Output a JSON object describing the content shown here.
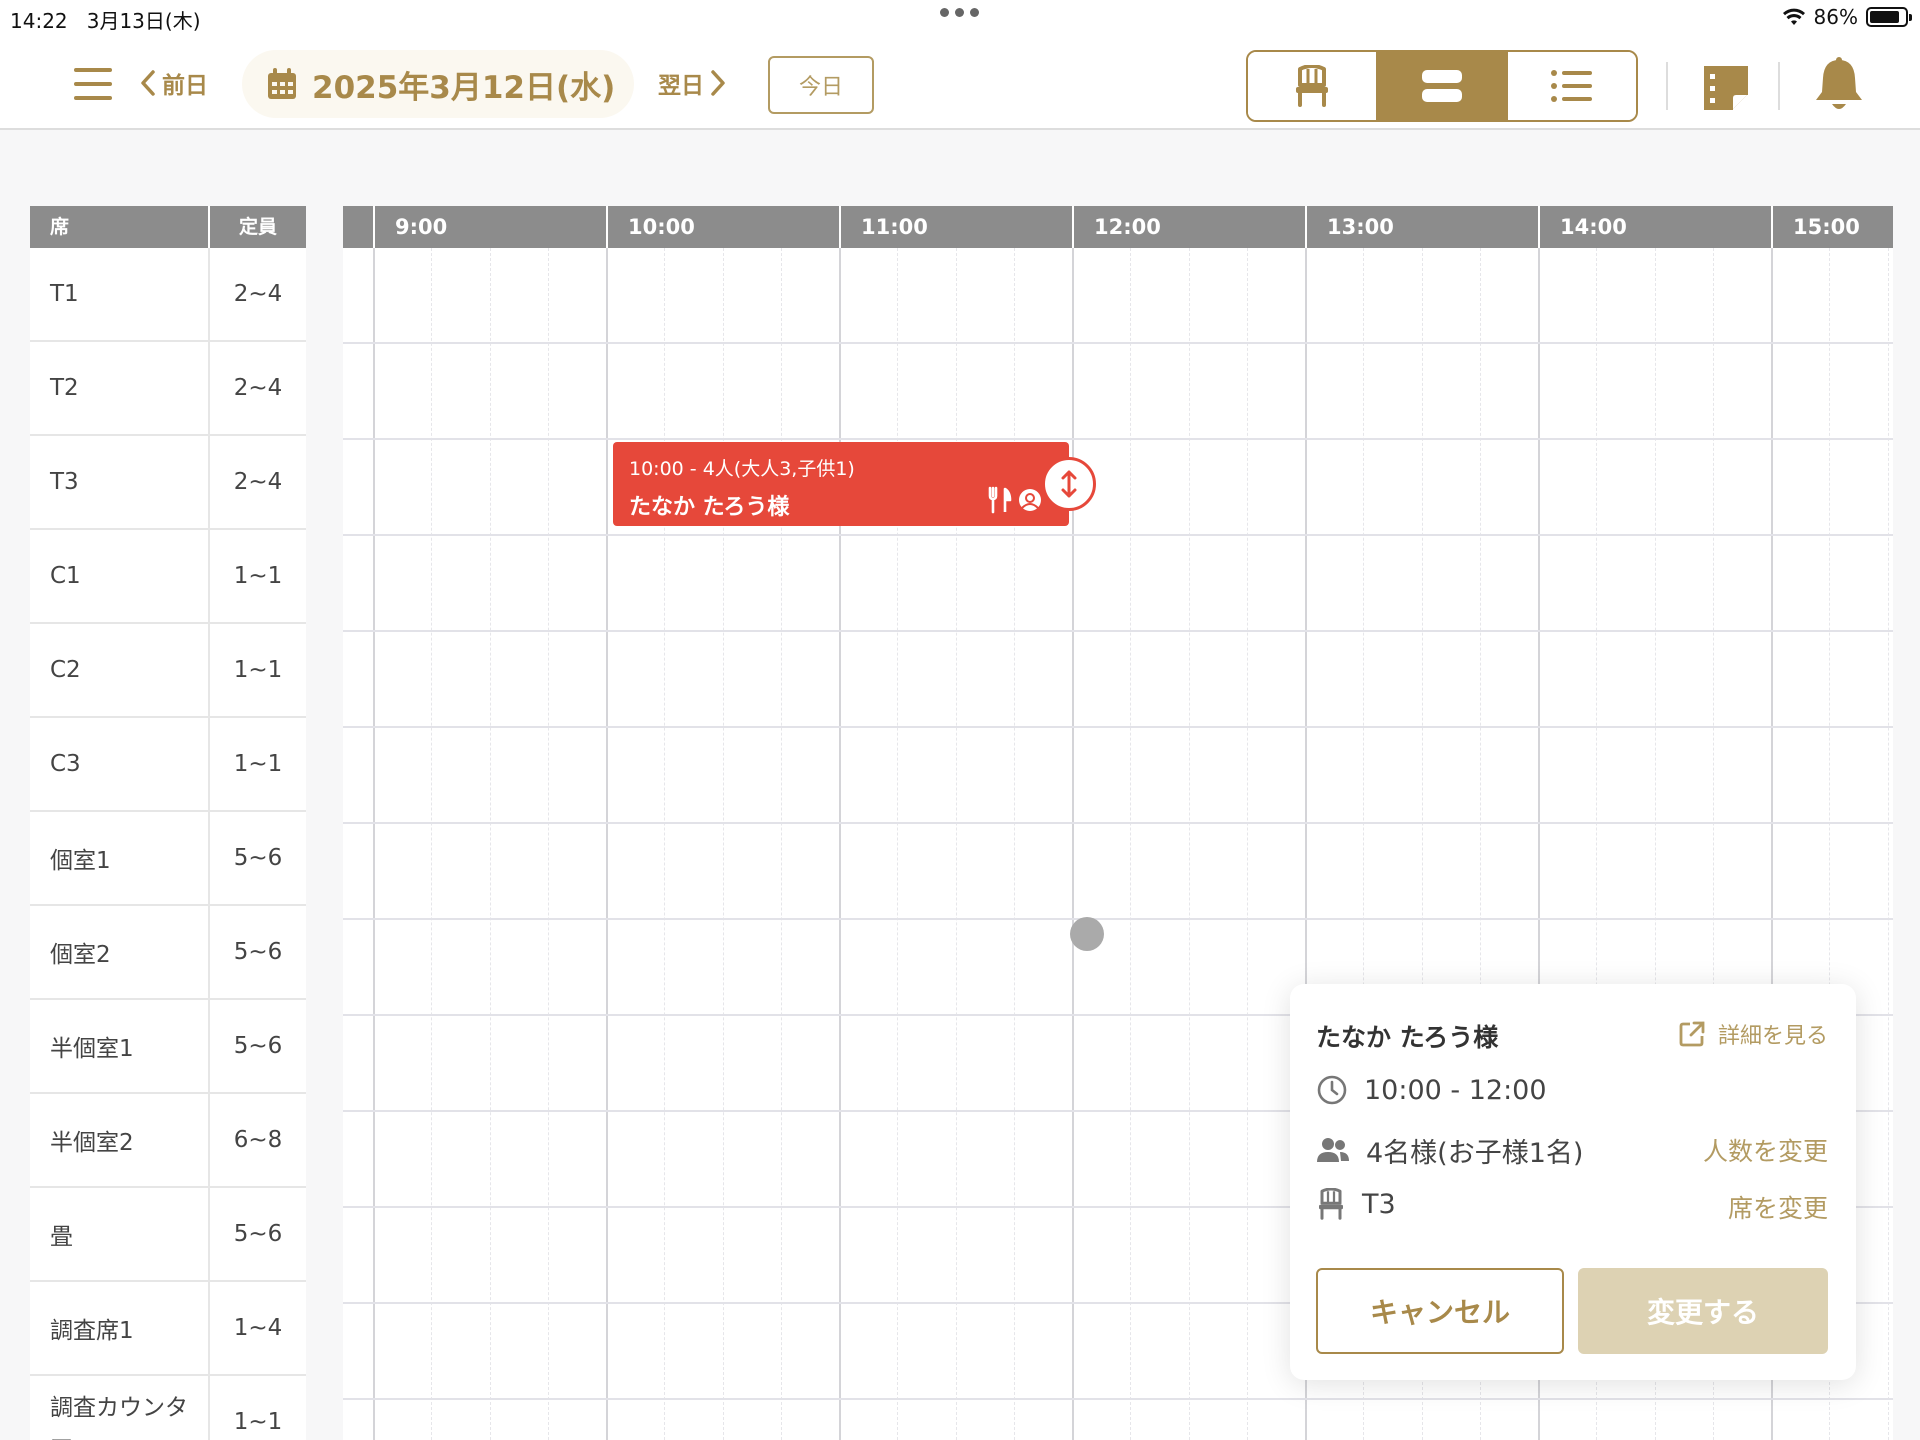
{
  "status_bar": {
    "time": "14:22",
    "date": "3月13日(木)",
    "battery": "86%"
  },
  "toolbar": {
    "prev_label": "前日",
    "current_date": "2025年3月12日(水)",
    "next_label": "翌日",
    "today_label": "今日",
    "views": [
      "seat",
      "timeline",
      "list"
    ],
    "active_view": "timeline"
  },
  "seat_table": {
    "header_seat": "席",
    "header_capacity": "定員",
    "rows": [
      {
        "name": "T1",
        "capacity": "2~4"
      },
      {
        "name": "T2",
        "capacity": "2~4"
      },
      {
        "name": "T3",
        "capacity": "2~4"
      },
      {
        "name": "C1",
        "capacity": "1~1"
      },
      {
        "name": "C2",
        "capacity": "1~1"
      },
      {
        "name": "C3",
        "capacity": "1~1"
      },
      {
        "name": "個室1",
        "capacity": "5~6"
      },
      {
        "name": "個室2",
        "capacity": "5~6"
      },
      {
        "name": "半個室1",
        "capacity": "5~6"
      },
      {
        "name": "半個室2",
        "capacity": "6~8"
      },
      {
        "name": "畳",
        "capacity": "5~6"
      },
      {
        "name": "調査席1",
        "capacity": "1~4"
      },
      {
        "name": "調査カウンター",
        "capacity": "1~1"
      }
    ]
  },
  "timeline": {
    "hours": [
      "9:00",
      "10:00",
      "11:00",
      "12:00",
      "13:00",
      "14:00",
      "15:00"
    ]
  },
  "reservation": {
    "time_party": "10:00 - 4人(大人3,子供1)",
    "name": "たなか たろう様",
    "seat": "T3",
    "start": "10:00",
    "end": "12:00",
    "color": "#e6483a"
  },
  "popup": {
    "name": "たなか たろう様",
    "detail_link": "詳細を見る",
    "time": "10:00 - 12:00",
    "party": "4名様(お子様1名)",
    "change_party": "人数を変更",
    "seat": "T3",
    "change_seat": "席を変更",
    "cancel": "キャンセル",
    "confirm": "変更する"
  },
  "colors": {
    "accent": "#a8894a",
    "reservation": "#e6483a",
    "header_gray": "#8c8c8c"
  }
}
